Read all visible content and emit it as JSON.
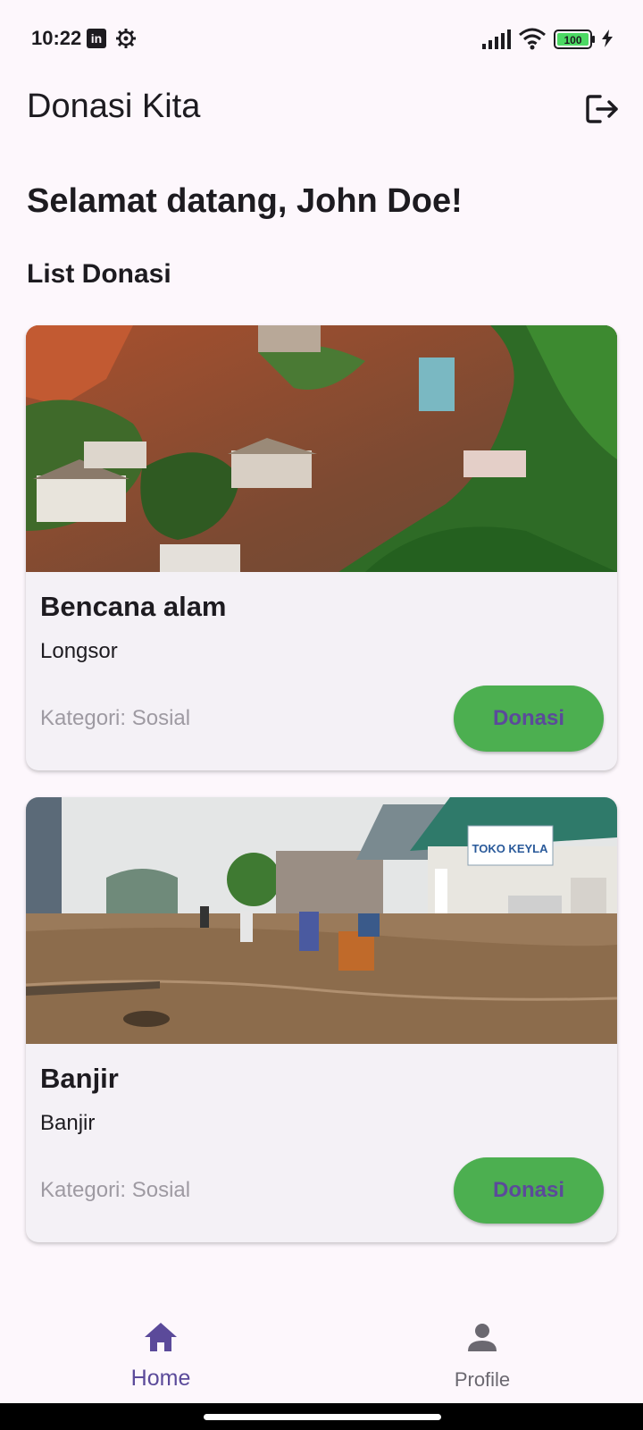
{
  "status_bar": {
    "time": "10:22",
    "battery": "100",
    "icons": [
      "linkedin-icon",
      "gear-icon",
      "signal-icon",
      "wifi-icon",
      "battery-icon",
      "charging-bolt-icon"
    ]
  },
  "app_bar": {
    "title": "Donasi Kita",
    "action_icon": "logout-icon"
  },
  "welcome_text": "Selamat datang, John Doe!",
  "section_title": "List Donasi",
  "donations": [
    {
      "title": "Bencana alam",
      "subtitle": "Longsor",
      "category": "Kategori: Sosial",
      "button_label": "Donasi",
      "image": "landslide-photo"
    },
    {
      "title": "Banjir",
      "subtitle": "Banjir",
      "category": "Kategori: Sosial",
      "button_label": "Donasi",
      "image": "flood-photo",
      "image_text": "TOKO KEYLA"
    }
  ],
  "bottom_nav": {
    "items": [
      {
        "label": "Home",
        "icon": "home-icon",
        "selected": true
      },
      {
        "label": "Profile",
        "icon": "person-icon",
        "selected": false
      }
    ]
  },
  "colors": {
    "background": "#fdf7fc",
    "card": "#f4f1f6",
    "button": "#4caf50",
    "accent": "#5b4a9a",
    "muted_text": "#9e9aa2"
  }
}
